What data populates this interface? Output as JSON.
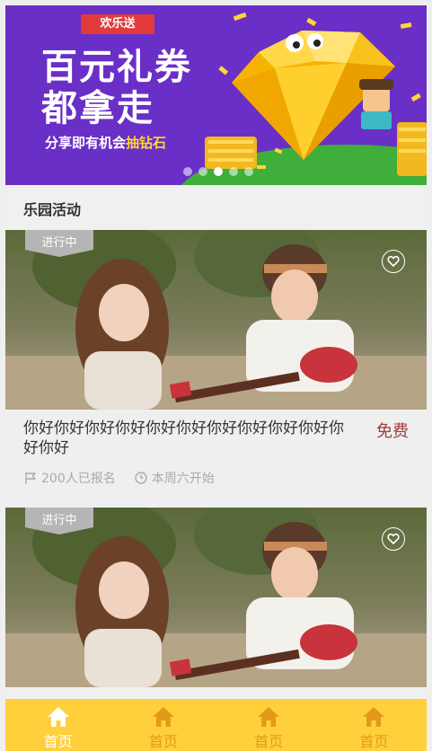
{
  "banner": {
    "ribbon": "欢乐送",
    "title_line1": "百元礼券",
    "title_line2": "都拿走",
    "subtitle_prefix": "分享即有机会",
    "subtitle_highlight": "抽钻石",
    "carousel_pages": 5,
    "carousel_active": 3
  },
  "section": {
    "title": "乐园活动"
  },
  "activities": [
    {
      "status": "进行中",
      "title": "你好你好你好你好你好你好你好你好你好你好你好你好",
      "price": "免费",
      "signups": "200人已报名",
      "start": "本周六开始"
    },
    {
      "status": "进行中"
    }
  ],
  "tabbar": {
    "tabs": [
      {
        "label": "首页",
        "icon": "home-icon",
        "active": true
      },
      {
        "label": "首页",
        "icon": "home-icon",
        "active": false
      },
      {
        "label": "首页",
        "icon": "home-icon",
        "active": false
      },
      {
        "label": "首页",
        "icon": "home-icon",
        "active": false
      }
    ]
  },
  "colors": {
    "banner_bg": "#6a2fc6",
    "accent_yellow": "#ffd03b",
    "tab_inactive": "#e49a19",
    "price_red": "#a23b3b",
    "tag_gray": "#b5b5b5"
  }
}
